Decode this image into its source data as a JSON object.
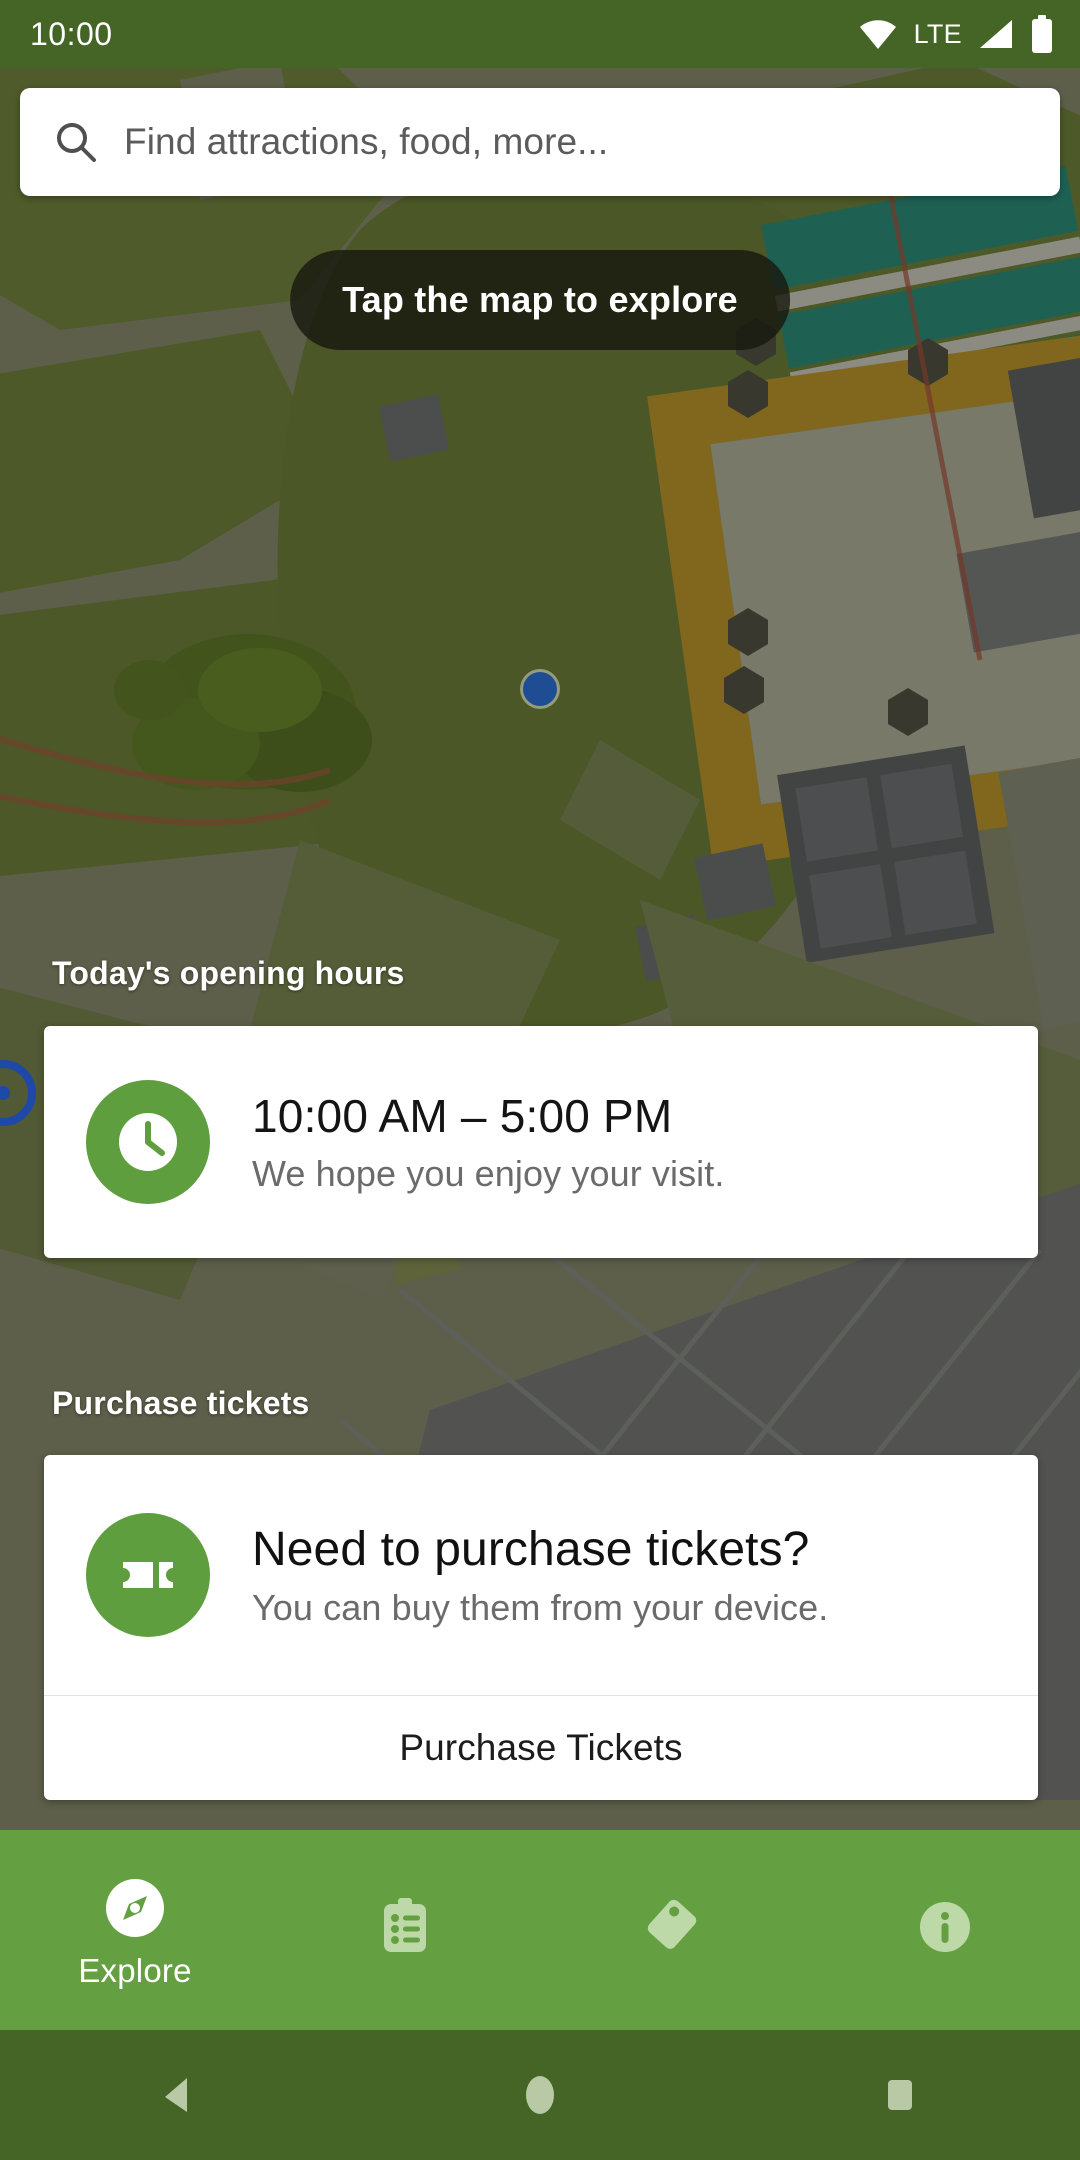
{
  "statusbar": {
    "time": "10:00",
    "network_label": "LTE",
    "icons": [
      "wifi-icon",
      "signal-icon",
      "battery-icon"
    ]
  },
  "search": {
    "placeholder": "Find attractions, food, more...",
    "icon": "search-icon"
  },
  "map": {
    "hint_pill": "Tap the map to explore",
    "user_location_marker": "location-dot",
    "colors": {
      "ground": "#8a8d72",
      "grass": "#6e8238",
      "path": "#c79a26",
      "building": "#5f6470",
      "water": "#1b8f80",
      "scrim": "rgba(30,32,18,0.42)"
    }
  },
  "sections": {
    "hours": {
      "title": "Today's opening hours",
      "icon": "clock-icon",
      "primary": "10:00 AM – 5:00 PM",
      "secondary": "We hope you enjoy your visit."
    },
    "tickets": {
      "title": "Purchase tickets",
      "icon": "ticket-icon",
      "primary": "Need to purchase tickets?",
      "secondary": "You can buy them from your device.",
      "action_label": "Purchase Tickets"
    }
  },
  "bottom_nav": {
    "accent": "#64a041",
    "items": [
      {
        "label": "Explore",
        "icon": "compass-icon",
        "active": true
      },
      {
        "label": "",
        "icon": "clipboard-list-icon",
        "active": false
      },
      {
        "label": "",
        "icon": "tag-icon",
        "active": false
      },
      {
        "label": "",
        "icon": "info-icon",
        "active": false
      }
    ]
  },
  "android_nav": {
    "back": "back-triangle-icon",
    "home": "home-circle-icon",
    "recents": "recents-square-icon"
  }
}
